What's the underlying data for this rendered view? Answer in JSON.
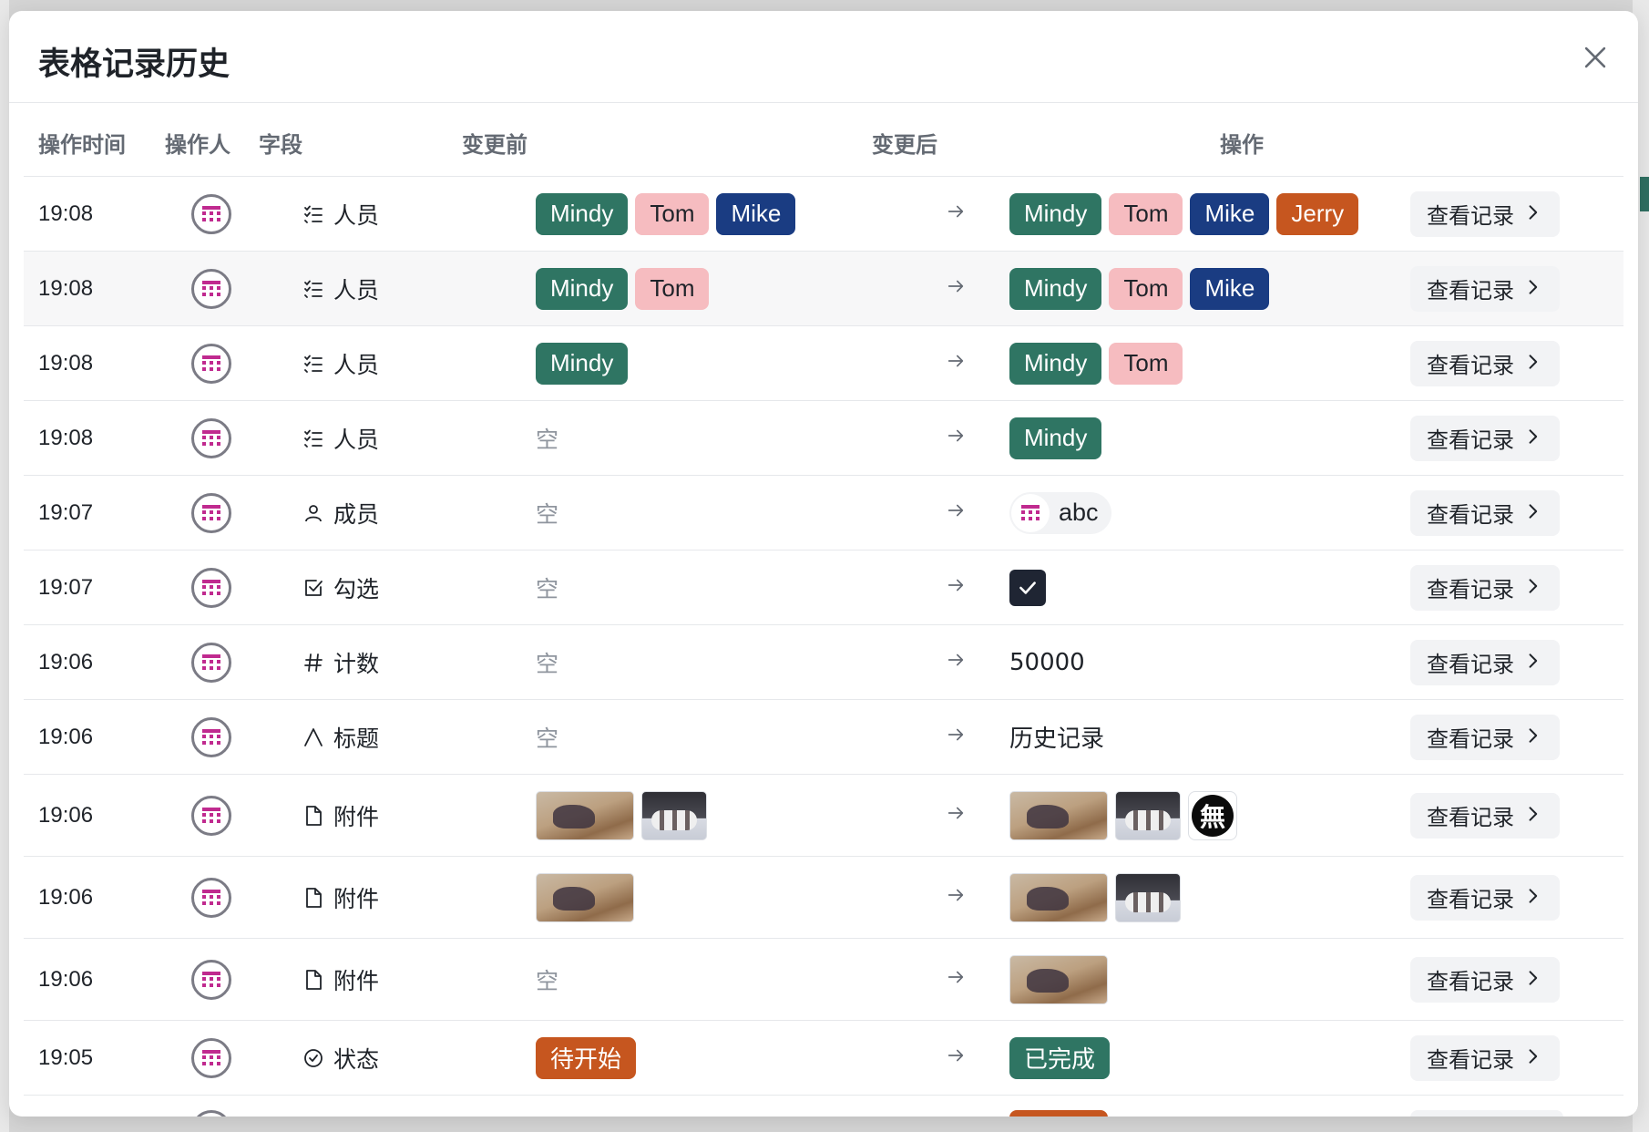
{
  "dialog": {
    "title": "表格记录历史",
    "close_icon": "close-icon"
  },
  "columns": {
    "time": "操作时间",
    "operator": "操作人",
    "field": "字段",
    "before": "变更前",
    "after": "变更后",
    "action": "操作"
  },
  "colors": {
    "tag_green": "#2f7563",
    "tag_pink": "#f6bcc0",
    "tag_navy": "#1a3c82",
    "tag_orange": "#c6561f"
  },
  "rows": [
    {
      "time": "19:08",
      "field": "人员",
      "field_icon": "list-icon",
      "before": [
        "Mindy",
        "Tom",
        "Mike"
      ],
      "after": [
        "Mindy",
        "Tom",
        "Mike",
        "Jerry"
      ],
      "action": "查看记录"
    },
    {
      "time": "19:08",
      "field": "人员",
      "field_icon": "list-icon",
      "before": [
        "Mindy",
        "Tom"
      ],
      "after": [
        "Mindy",
        "Tom",
        "Mike"
      ],
      "action": "查看记录"
    },
    {
      "time": "19:08",
      "field": "人员",
      "field_icon": "list-icon",
      "before": [
        "Mindy"
      ],
      "after": [
        "Mindy",
        "Tom"
      ],
      "action": "查看记录"
    },
    {
      "time": "19:08",
      "field": "人员",
      "field_icon": "list-icon",
      "before": "空",
      "after": [
        "Mindy"
      ],
      "action": "查看记录"
    },
    {
      "time": "19:07",
      "field": "成员",
      "field_icon": "person-icon",
      "before": "空",
      "after": "abc",
      "action": "查看记录"
    },
    {
      "time": "19:07",
      "field": "勾选",
      "field_icon": "checkbox-icon",
      "before": "空",
      "after": "checked",
      "action": "查看记录"
    },
    {
      "time": "19:06",
      "field": "计数",
      "field_icon": "hash-icon",
      "before": "空",
      "after": "50000",
      "action": "查看记录"
    },
    {
      "time": "19:06",
      "field": "标题",
      "field_icon": "text-icon",
      "before": "空",
      "after": "历史记录",
      "action": "查看记录"
    },
    {
      "time": "19:06",
      "field": "附件",
      "field_icon": "file-icon",
      "before": [
        "horse-image",
        "dogs-image"
      ],
      "after": [
        "horse-image",
        "dogs-image",
        "wu-logo-image"
      ],
      "action": "查看记录"
    },
    {
      "time": "19:06",
      "field": "附件",
      "field_icon": "file-icon",
      "before": [
        "horse-image"
      ],
      "after": [
        "horse-image",
        "dogs-image"
      ],
      "action": "查看记录"
    },
    {
      "time": "19:06",
      "field": "附件",
      "field_icon": "file-icon",
      "before": "空",
      "after": [
        "horse-image"
      ],
      "action": "查看记录"
    },
    {
      "time": "19:05",
      "field": "状态",
      "field_icon": "status-circle-icon",
      "before": [
        "待开始"
      ],
      "after": [
        "已完成"
      ],
      "action": "查看记录"
    }
  ],
  "mu_logo_text": "無"
}
